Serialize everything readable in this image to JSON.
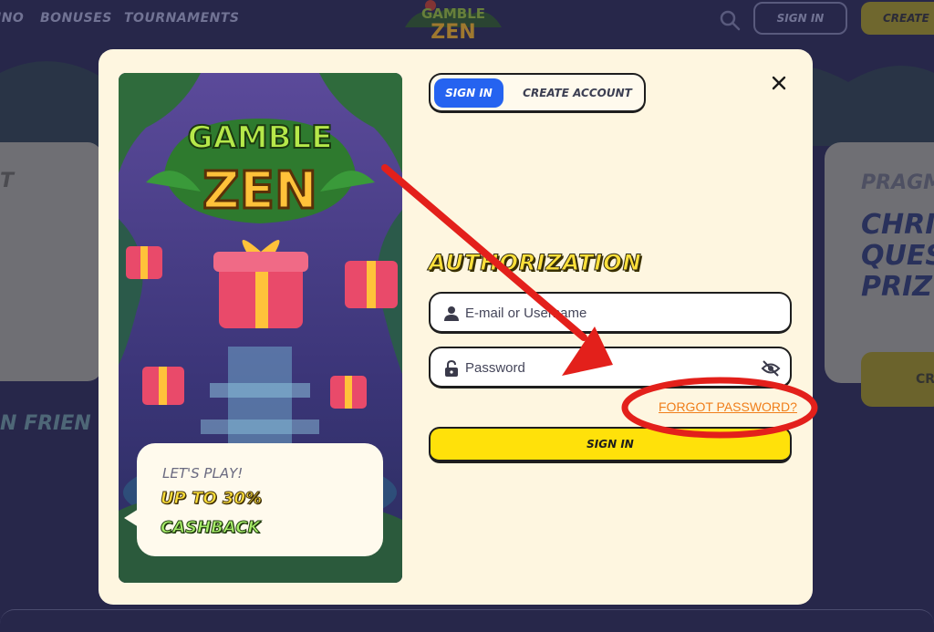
{
  "background": {
    "nav_links": [
      "INO",
      "BONUSES",
      "TOURNAMENTS"
    ],
    "logo_line1": "GAMBLE",
    "logo_line2": "ZEN",
    "header_signin": "SIGN IN",
    "header_create": "CREATE",
    "left_card_text": "T",
    "friend_text": "N FRIEN",
    "right_card_line1": "PRAGM",
    "right_card_line2": [
      "CHRI",
      "QUES",
      "PRIZ"
    ],
    "right_card_button": "CR"
  },
  "modal": {
    "tabs": {
      "signin": "SIGN IN",
      "create": "CREATE ACCOUNT"
    },
    "close_icon": "close-icon",
    "promo": {
      "logo_line1": "GAMBLE",
      "logo_line2": "ZEN",
      "lets_play": "LET'S PLAY!",
      "offer_line1": "UP TO 30%",
      "offer_line2": "CASHBACK"
    },
    "form": {
      "title": "AUTHORIZATION",
      "email_placeholder": "E-mail or Username",
      "password_placeholder": "Password",
      "forgot_link": "FORGOT PASSWORD?",
      "submit": "SIGN IN"
    }
  },
  "annotation": {
    "arrow_color": "#e3201b",
    "highlight_color": "#e3201b"
  },
  "colors": {
    "modal_bg": "#fef6e0",
    "accent_blue": "#2563f0",
    "accent_yellow": "#ffe10a",
    "link_orange": "#f07e1a"
  }
}
